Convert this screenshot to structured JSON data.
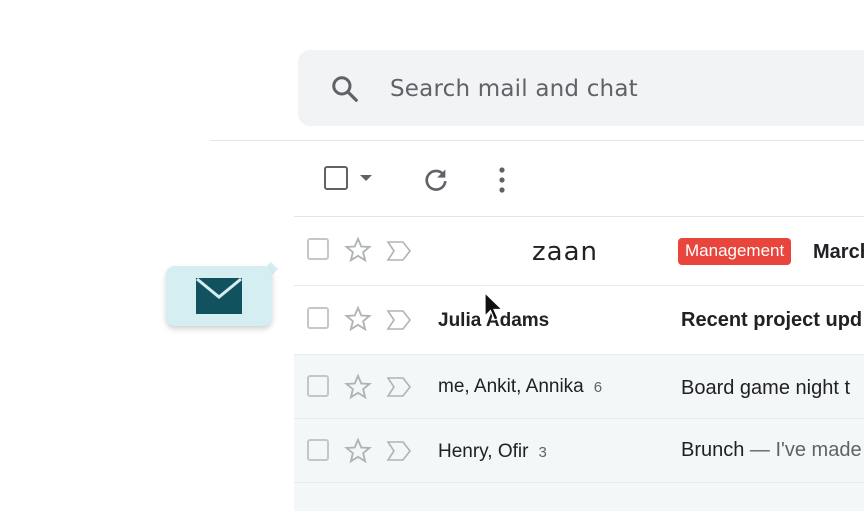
{
  "search": {
    "placeholder": "Search mail and chat"
  },
  "typed_text": "zaan",
  "rows": [
    {
      "sender": "",
      "count": "",
      "label": "Management",
      "subject": "March",
      "snippet": ""
    },
    {
      "sender": "Julia Adams",
      "count": "",
      "label": "",
      "subject": "Recent project upd",
      "snippet": ""
    },
    {
      "sender": "me, Ankit, Annika",
      "count": "6",
      "label": "",
      "subject": "Board game night t",
      "snippet": ""
    },
    {
      "sender": "Henry, Ofir",
      "count": "3",
      "label": "",
      "subject": "Brunch",
      "snippet": " — I've made"
    }
  ],
  "colors": {
    "label_red": "#e8453c",
    "mail_badge_bg": "#d4eef1",
    "mail_icon": "#12525f",
    "search_bg": "#f1f3f4"
  }
}
